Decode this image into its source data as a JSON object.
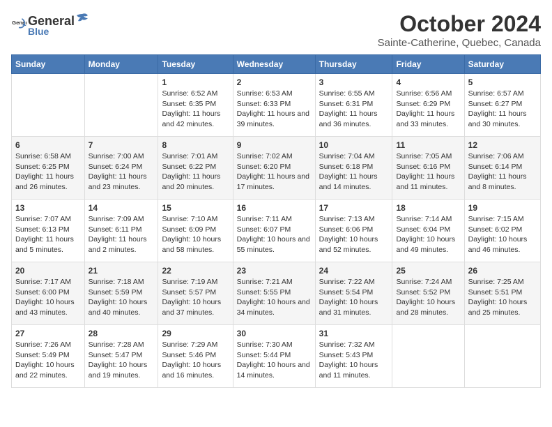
{
  "logo": {
    "general": "General",
    "blue": "Blue"
  },
  "title": "October 2024",
  "subtitle": "Sainte-Catherine, Quebec, Canada",
  "days_of_week": [
    "Sunday",
    "Monday",
    "Tuesday",
    "Wednesday",
    "Thursday",
    "Friday",
    "Saturday"
  ],
  "weeks": [
    [
      {
        "day": "",
        "info": ""
      },
      {
        "day": "",
        "info": ""
      },
      {
        "day": "1",
        "info": "Sunrise: 6:52 AM\nSunset: 6:35 PM\nDaylight: 11 hours and 42 minutes."
      },
      {
        "day": "2",
        "info": "Sunrise: 6:53 AM\nSunset: 6:33 PM\nDaylight: 11 hours and 39 minutes."
      },
      {
        "day": "3",
        "info": "Sunrise: 6:55 AM\nSunset: 6:31 PM\nDaylight: 11 hours and 36 minutes."
      },
      {
        "day": "4",
        "info": "Sunrise: 6:56 AM\nSunset: 6:29 PM\nDaylight: 11 hours and 33 minutes."
      },
      {
        "day": "5",
        "info": "Sunrise: 6:57 AM\nSunset: 6:27 PM\nDaylight: 11 hours and 30 minutes."
      }
    ],
    [
      {
        "day": "6",
        "info": "Sunrise: 6:58 AM\nSunset: 6:25 PM\nDaylight: 11 hours and 26 minutes."
      },
      {
        "day": "7",
        "info": "Sunrise: 7:00 AM\nSunset: 6:24 PM\nDaylight: 11 hours and 23 minutes."
      },
      {
        "day": "8",
        "info": "Sunrise: 7:01 AM\nSunset: 6:22 PM\nDaylight: 11 hours and 20 minutes."
      },
      {
        "day": "9",
        "info": "Sunrise: 7:02 AM\nSunset: 6:20 PM\nDaylight: 11 hours and 17 minutes."
      },
      {
        "day": "10",
        "info": "Sunrise: 7:04 AM\nSunset: 6:18 PM\nDaylight: 11 hours and 14 minutes."
      },
      {
        "day": "11",
        "info": "Sunrise: 7:05 AM\nSunset: 6:16 PM\nDaylight: 11 hours and 11 minutes."
      },
      {
        "day": "12",
        "info": "Sunrise: 7:06 AM\nSunset: 6:14 PM\nDaylight: 11 hours and 8 minutes."
      }
    ],
    [
      {
        "day": "13",
        "info": "Sunrise: 7:07 AM\nSunset: 6:13 PM\nDaylight: 11 hours and 5 minutes."
      },
      {
        "day": "14",
        "info": "Sunrise: 7:09 AM\nSunset: 6:11 PM\nDaylight: 11 hours and 2 minutes."
      },
      {
        "day": "15",
        "info": "Sunrise: 7:10 AM\nSunset: 6:09 PM\nDaylight: 10 hours and 58 minutes."
      },
      {
        "day": "16",
        "info": "Sunrise: 7:11 AM\nSunset: 6:07 PM\nDaylight: 10 hours and 55 minutes."
      },
      {
        "day": "17",
        "info": "Sunrise: 7:13 AM\nSunset: 6:06 PM\nDaylight: 10 hours and 52 minutes."
      },
      {
        "day": "18",
        "info": "Sunrise: 7:14 AM\nSunset: 6:04 PM\nDaylight: 10 hours and 49 minutes."
      },
      {
        "day": "19",
        "info": "Sunrise: 7:15 AM\nSunset: 6:02 PM\nDaylight: 10 hours and 46 minutes."
      }
    ],
    [
      {
        "day": "20",
        "info": "Sunrise: 7:17 AM\nSunset: 6:00 PM\nDaylight: 10 hours and 43 minutes."
      },
      {
        "day": "21",
        "info": "Sunrise: 7:18 AM\nSunset: 5:59 PM\nDaylight: 10 hours and 40 minutes."
      },
      {
        "day": "22",
        "info": "Sunrise: 7:19 AM\nSunset: 5:57 PM\nDaylight: 10 hours and 37 minutes."
      },
      {
        "day": "23",
        "info": "Sunrise: 7:21 AM\nSunset: 5:55 PM\nDaylight: 10 hours and 34 minutes."
      },
      {
        "day": "24",
        "info": "Sunrise: 7:22 AM\nSunset: 5:54 PM\nDaylight: 10 hours and 31 minutes."
      },
      {
        "day": "25",
        "info": "Sunrise: 7:24 AM\nSunset: 5:52 PM\nDaylight: 10 hours and 28 minutes."
      },
      {
        "day": "26",
        "info": "Sunrise: 7:25 AM\nSunset: 5:51 PM\nDaylight: 10 hours and 25 minutes."
      }
    ],
    [
      {
        "day": "27",
        "info": "Sunrise: 7:26 AM\nSunset: 5:49 PM\nDaylight: 10 hours and 22 minutes."
      },
      {
        "day": "28",
        "info": "Sunrise: 7:28 AM\nSunset: 5:47 PM\nDaylight: 10 hours and 19 minutes."
      },
      {
        "day": "29",
        "info": "Sunrise: 7:29 AM\nSunset: 5:46 PM\nDaylight: 10 hours and 16 minutes."
      },
      {
        "day": "30",
        "info": "Sunrise: 7:30 AM\nSunset: 5:44 PM\nDaylight: 10 hours and 14 minutes."
      },
      {
        "day": "31",
        "info": "Sunrise: 7:32 AM\nSunset: 5:43 PM\nDaylight: 10 hours and 11 minutes."
      },
      {
        "day": "",
        "info": ""
      },
      {
        "day": "",
        "info": ""
      }
    ]
  ]
}
